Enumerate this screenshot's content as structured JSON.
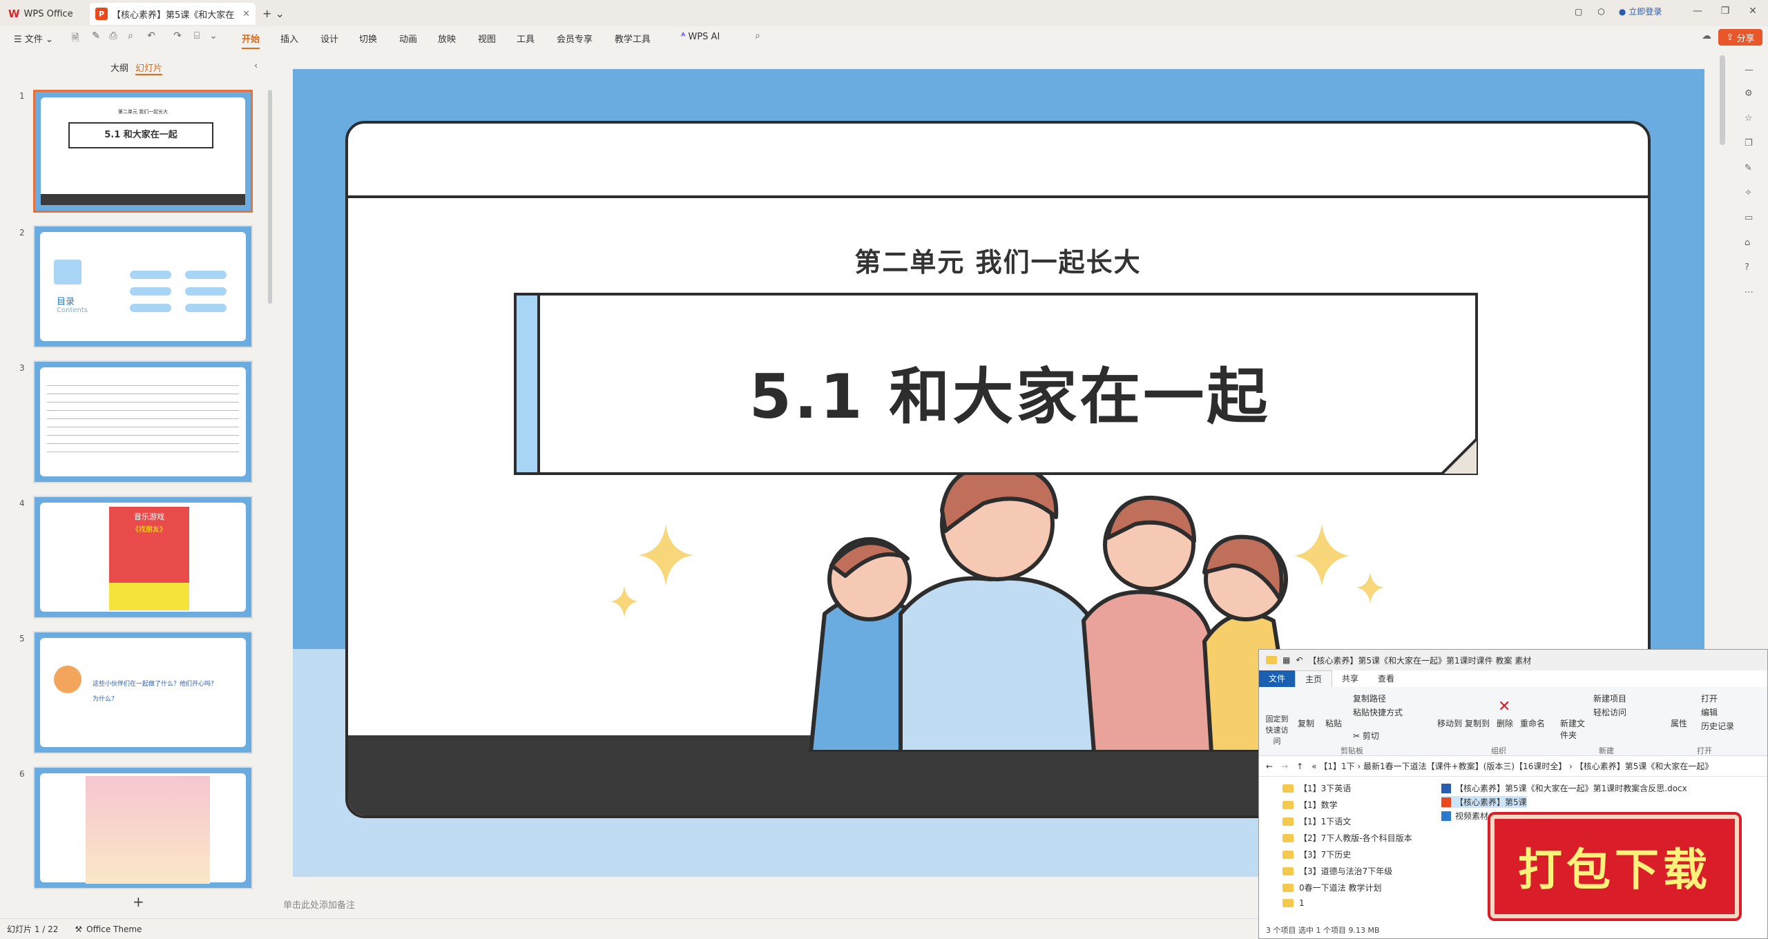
{
  "titlebar": {
    "home_tab": "WPS Office",
    "doc_tab": "【核心素养】第5课《和大家在",
    "login": "立即登录"
  },
  "menu": {
    "file": "文件",
    "items": [
      "开始",
      "插入",
      "设计",
      "切换",
      "动画",
      "放映",
      "视图",
      "工具",
      "会员专享",
      "教学工具"
    ],
    "wps_ai": "WPS AI",
    "share": "分享"
  },
  "panel": {
    "outline": "大纲",
    "slides": "幻灯片",
    "thumb_numbers": [
      "1",
      "2",
      "3",
      "4",
      "5",
      "6"
    ],
    "add": "+",
    "thumb1_title": "5.1 和大家在一起",
    "thumb1_sub": "第二单元 我们一起长大",
    "thumb2_label": "目录",
    "thumb2_en": "Contents",
    "thumb4_title": "音乐游戏",
    "thumb4_sub": "《找朋友》",
    "thumb5_text": "这些小伙伴们在一起做了什么？他们开心吗？为什么？"
  },
  "slide": {
    "subtitle": "第二单元   我们一起长大",
    "title": "5.1  和大家在一起"
  },
  "notes": "单击此处添加备注",
  "status": {
    "slide_count": "幻灯片 1 / 22",
    "theme": "Office Theme"
  },
  "explorer": {
    "title": "【核心素养】第5课《和大家在一起》第1课时课件 教案 素材",
    "tabs": [
      "文件",
      "主页",
      "共享",
      "查看"
    ],
    "ribbon": {
      "pin": "固定到快速访问",
      "copy": "复制",
      "paste": "粘贴",
      "copy_path": "复制路径",
      "paste_shortcut": "粘贴快捷方式",
      "cut": "剪切",
      "group_clipboard": "剪贴板",
      "move_to": "移动到",
      "copy_to": "复制到",
      "delete": "删除",
      "rename": "重命名",
      "group_organize": "组织",
      "new_folder": "新建文件夹",
      "new_item": "新建项目",
      "easy_access": "轻松访问",
      "group_new": "新建",
      "properties": "属性",
      "open": "打开",
      "edit": "编辑",
      "history": "历史记录",
      "group_open": "打开"
    },
    "address": "«  【1】1下  ›  最新1春一下道法【课件+教案】(版本三)【16课时全】  ›  【核心素养】第5课《和大家在一起》",
    "tree": [
      "【1】3下英语",
      "【1】数学",
      "【1】1下语文",
      "【2】7下人教版-各个科目版本",
      "【3】7下历史",
      "【3】道德与法治7下年级",
      "0春一下道法 教学计划",
      "1"
    ],
    "files": [
      "【核心素养】第5课《和大家在一起》第1课时教案含反思.docx",
      "【核心素养】第5课",
      "视频素材"
    ],
    "status": "3 个项目    选中 1 个项目  9.13 MB"
  },
  "download_badge": "打包下载",
  "colors": {
    "accent": "#e8572a",
    "slide_bg": "#6aacdf",
    "banner_bar": "#a8d4f5"
  }
}
